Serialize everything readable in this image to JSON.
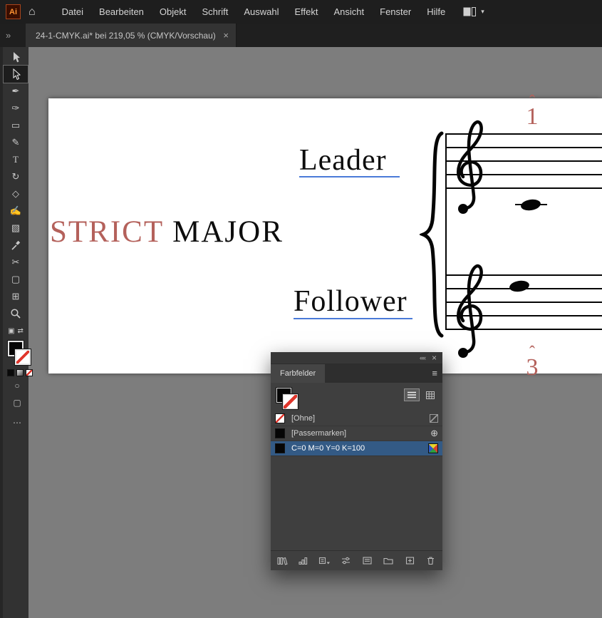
{
  "app": {
    "logo_text": "Ai",
    "menu": {
      "items": [
        "Datei",
        "Bearbeiten",
        "Objekt",
        "Schrift",
        "Auswahl",
        "Effekt",
        "Ansicht",
        "Fenster",
        "Hilfe"
      ]
    },
    "tab": {
      "title": "24-1-CMYK.ai* bei 219,05 % (CMYK/Vorschau)"
    }
  },
  "icons": {
    "home": "⌂",
    "dock_expand": "»",
    "close": "×",
    "collapse": "««",
    "chevron_down": "▾",
    "panel_menu": "≡",
    "registration": "⊕",
    "more_dots": "⋯"
  },
  "toolbar": {
    "tools": [
      {
        "name": "selection-tool"
      },
      {
        "name": "direct-selection-tool",
        "active": true
      },
      {
        "name": "pen-tool",
        "glyph": "✒"
      },
      {
        "name": "curvature-tool",
        "glyph": "✑"
      },
      {
        "name": "rectangle-tool",
        "glyph": "▭"
      },
      {
        "name": "paintbrush-tool",
        "glyph": "✎"
      },
      {
        "name": "type-tool",
        "glyph": "T"
      },
      {
        "name": "rotate-tool",
        "glyph": "↻"
      },
      {
        "name": "eraser-tool",
        "glyph": "◇"
      },
      {
        "name": "shape-builder-tool",
        "glyph": "✍"
      },
      {
        "name": "gradient-tool",
        "glyph": "▧"
      },
      {
        "name": "eyedropper-tool"
      },
      {
        "name": "scissors-tool",
        "glyph": "✂"
      },
      {
        "name": "artboard-tool",
        "glyph": "▢"
      },
      {
        "name": "perspective-grid-tool",
        "glyph": "⊞"
      },
      {
        "name": "zoom-tool"
      },
      {
        "name": "screen-split",
        "glyph": "▣"
      },
      {
        "name": "swap-view",
        "glyph": "⇄"
      }
    ],
    "extras": [
      {
        "name": "draw-mode",
        "glyph": "○"
      },
      {
        "name": "screen-mode",
        "glyph": "▢"
      },
      {
        "name": "edit-toolbar",
        "glyph": "⋯"
      }
    ]
  },
  "artboard": {
    "leader": "Leader",
    "follower": "Follower",
    "strict": "STRICT",
    "major": "MAJOR",
    "degree_top": {
      "caret": "ˆ",
      "digit": "1"
    },
    "degree_bottom": {
      "caret": "ˆ",
      "digit": "3"
    }
  },
  "swatches_panel": {
    "title": "Farbfelder",
    "rows": [
      {
        "label": "[Ohne]"
      },
      {
        "label": "[Passermarken]"
      },
      {
        "label": "C=0 M=0 Y=0 K=100",
        "selected": true
      }
    ]
  },
  "colors": {
    "accent_red": "#b4615b",
    "selection_blue": "#335a85",
    "underline_blue": "#4a7ad8",
    "swatch_none_red": "#e0362c"
  }
}
